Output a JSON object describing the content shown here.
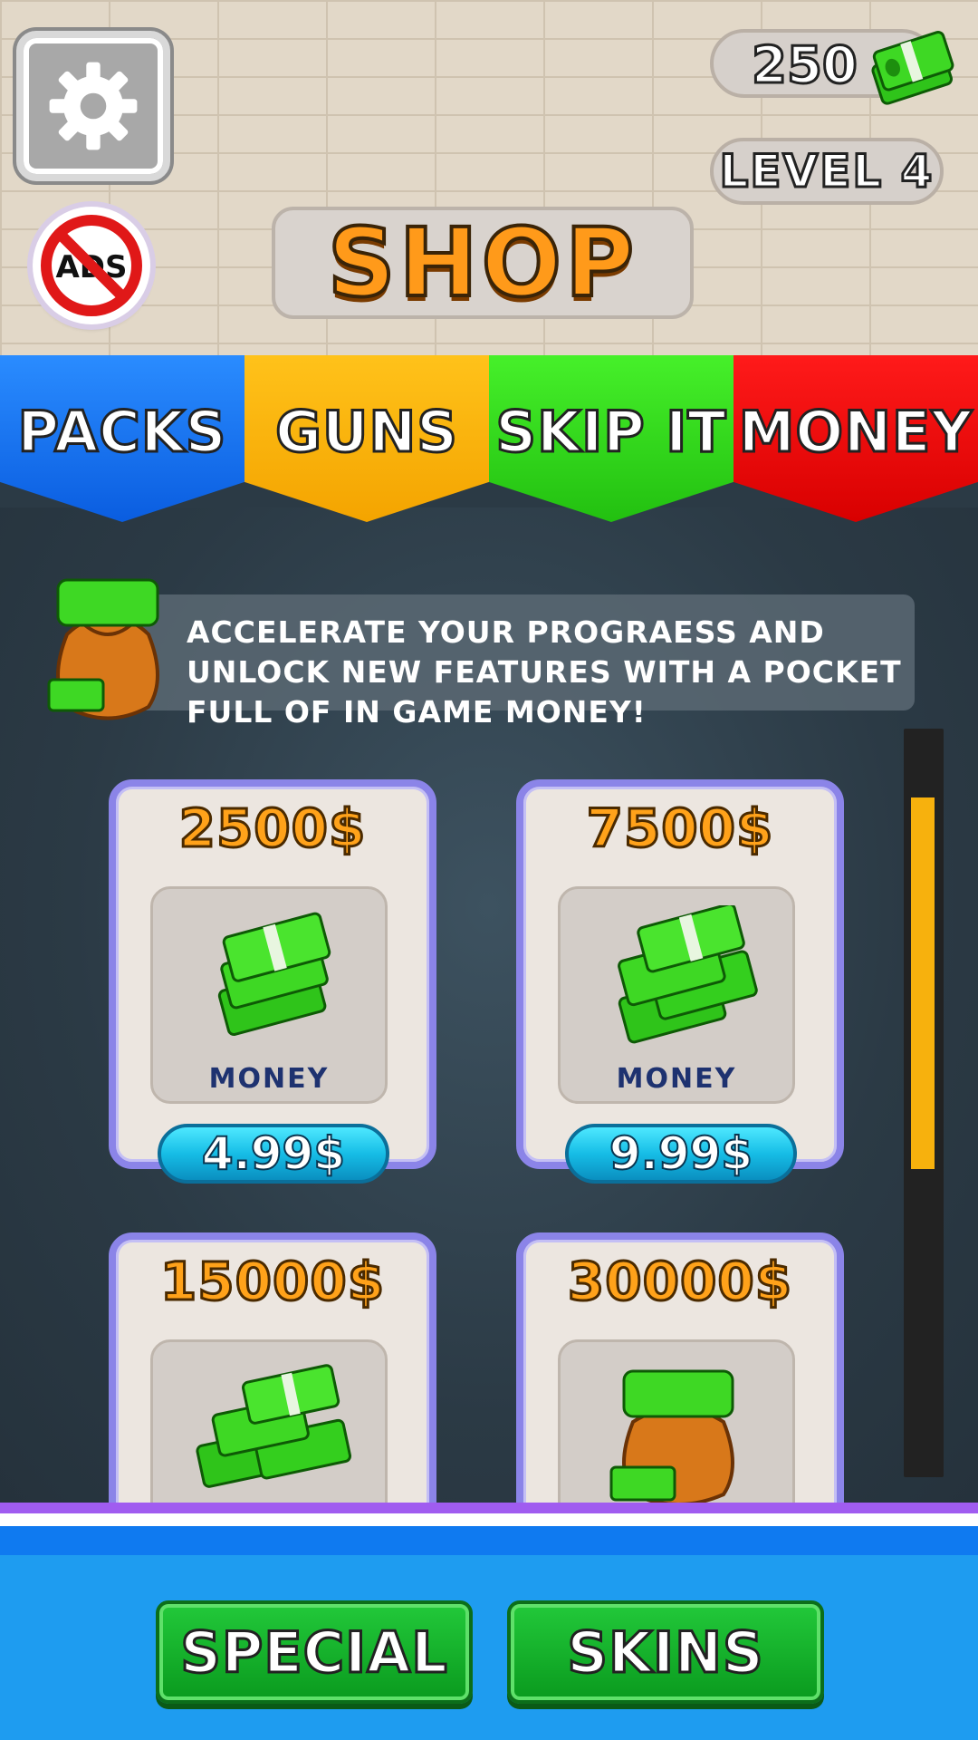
{
  "header": {
    "title": "SHOP",
    "currency": "250",
    "level": "LEVEL 4",
    "no_ads_label": "ADS"
  },
  "tabs": [
    {
      "label": "PACKS",
      "color": "#0a5de0"
    },
    {
      "label": "GUNS",
      "color": "#f4a400"
    },
    {
      "label": "SKIP IT",
      "color": "#22c010"
    },
    {
      "label": "MONEY",
      "color": "#d80000"
    }
  ],
  "info": {
    "text": "ACCELERATE YOUR PROGRAESS AND UNLOCK NEW FEATURES WITH A POCKET FULL OF IN GAME MONEY!"
  },
  "items": [
    {
      "amount": "2500$",
      "label": "MONEY",
      "price": "4.99$",
      "icon": "cash-stack-icon"
    },
    {
      "amount": "7500$",
      "label": "MONEY",
      "price": "9.99$",
      "icon": "cash-pile-icon"
    },
    {
      "amount": "15000$",
      "icon": "cash-heap-icon"
    },
    {
      "amount": "30000$",
      "icon": "money-bag-icon"
    }
  ],
  "bottom": {
    "special": "SPECIAL",
    "skins": "SKINS"
  },
  "colors": {
    "scroll_thumb": "#f7b10d",
    "bottom_bar": "#1e9cf0"
  }
}
